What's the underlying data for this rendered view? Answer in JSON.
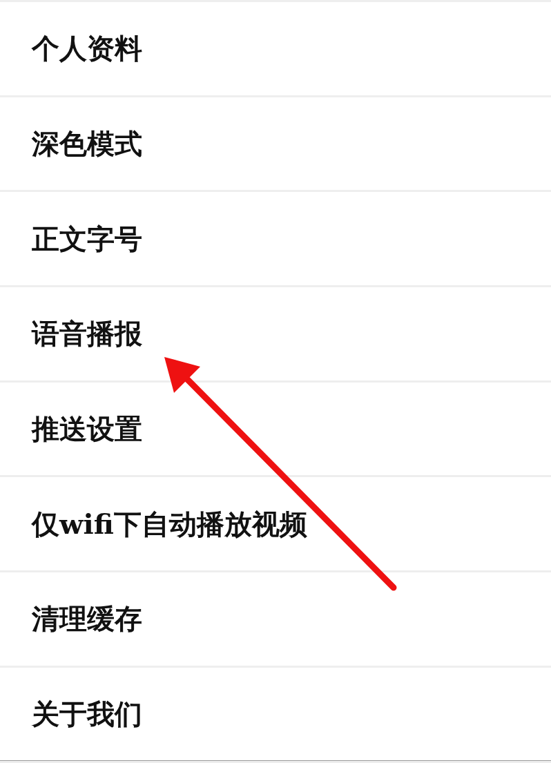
{
  "settings": [
    {
      "label": "个人资料"
    },
    {
      "label": "深色模式"
    },
    {
      "label": "正文字号"
    },
    {
      "label": "语音播报"
    },
    {
      "label": "推送设置"
    },
    {
      "label": "仅wifi下自动播放视频"
    },
    {
      "label": "清理缓存"
    },
    {
      "label": "关于我们"
    }
  ]
}
